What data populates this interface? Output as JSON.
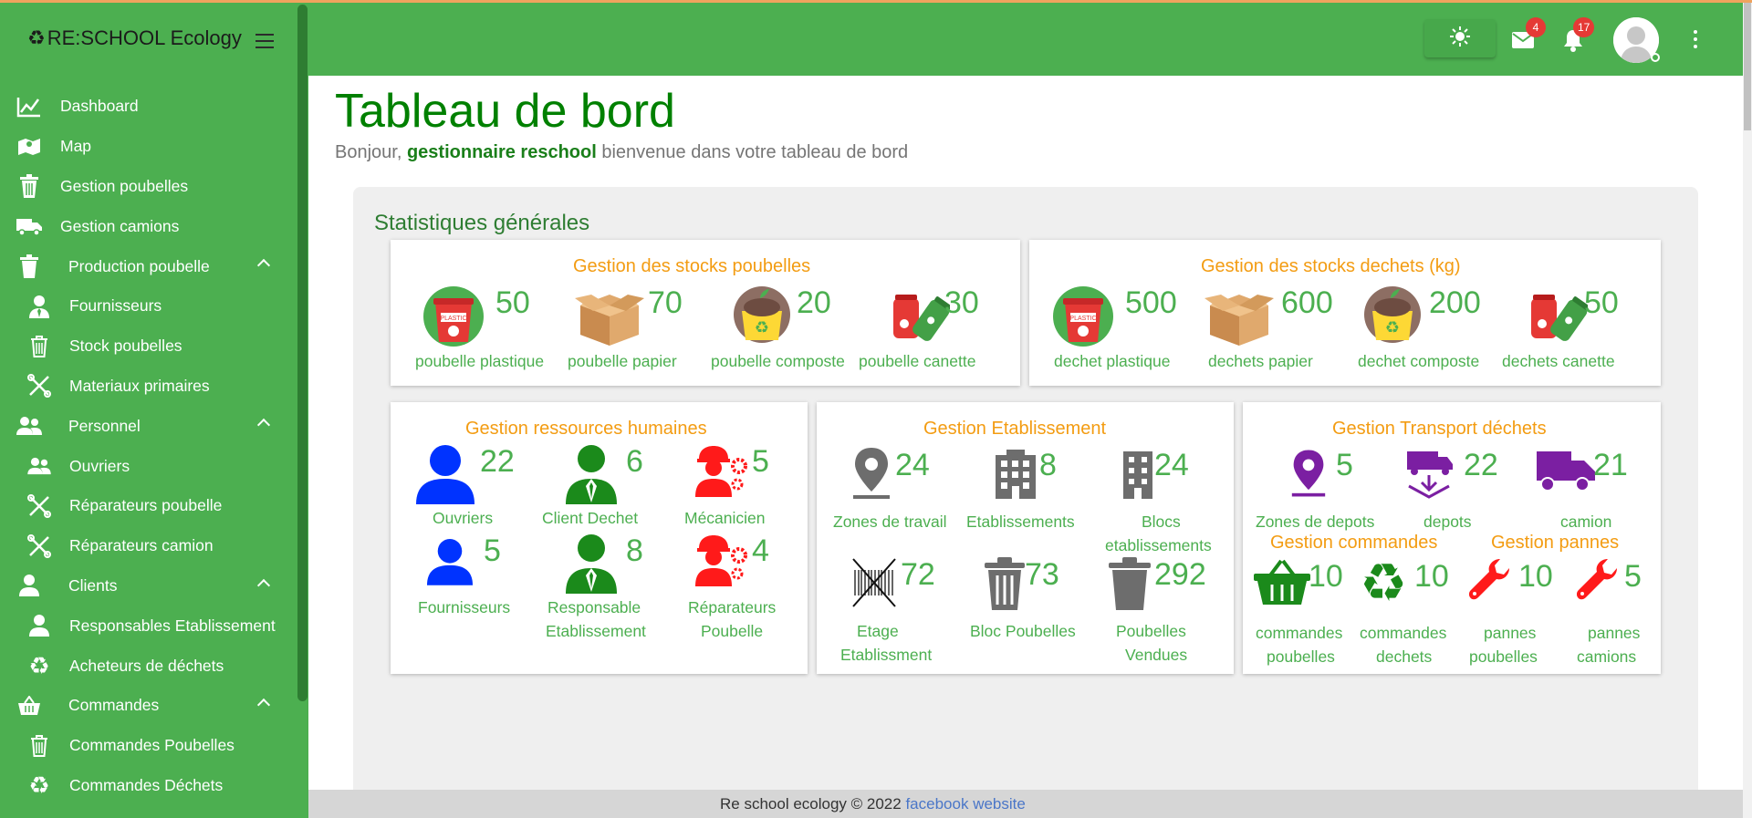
{
  "app": {
    "brand_logo": "♻",
    "brand_name": "RE:SCHOOL Ecology"
  },
  "sidebar": {
    "items": [
      {
        "label": "Dashboard",
        "icon": "chart-line-icon",
        "level": 0
      },
      {
        "label": "Map",
        "icon": "map-icon",
        "level": 0
      },
      {
        "label": "Gestion poubelles",
        "icon": "trash-icon",
        "level": 0
      },
      {
        "label": "Gestion camions",
        "icon": "truck-icon",
        "level": 0
      },
      {
        "label": "Production poubelle",
        "icon": "trash-icon",
        "level": "group"
      },
      {
        "label": "Fournisseurs",
        "icon": "user-tie-icon",
        "level": 1
      },
      {
        "label": "Stock poubelles",
        "icon": "trash-outline-icon",
        "level": 1
      },
      {
        "label": "Materiaux primaires",
        "icon": "tools-icon",
        "level": 1
      },
      {
        "label": "Personnel",
        "icon": "users-icon",
        "level": "group"
      },
      {
        "label": "Ouvriers",
        "icon": "users-icon",
        "level": 1
      },
      {
        "label": "Réparateurs poubelle",
        "icon": "tools-icon",
        "level": 1
      },
      {
        "label": "Réparateurs camion",
        "icon": "tools-icon",
        "level": 1
      },
      {
        "label": "Clients",
        "icon": "user-icon",
        "level": "group"
      },
      {
        "label": "Responsables Etablissement",
        "icon": "user-icon",
        "level": 1
      },
      {
        "label": "Acheteurs de déchets",
        "icon": "recycle-icon",
        "level": 1
      },
      {
        "label": "Commandes",
        "icon": "basket-icon",
        "level": "group"
      },
      {
        "label": "Commandes Poubelles",
        "icon": "trash-outline-icon",
        "level": 1
      },
      {
        "label": "Commandes Déchets",
        "icon": "recycle-icon",
        "level": 1
      }
    ]
  },
  "header": {
    "mail_badge": "4",
    "notif_badge": "17"
  },
  "page": {
    "title": "Tableau de bord",
    "greeting": "Bonjour,",
    "user": "gestionnaire reschool",
    "welcome": "bienvenue dans votre tableau de bord",
    "section_title": "Statistiques générales"
  },
  "stocks_poubelles": {
    "title": "Gestion des stocks poubelles",
    "items": [
      {
        "value": "50",
        "label": "poubelle plastique"
      },
      {
        "value": "70",
        "label": "poubelle papier"
      },
      {
        "value": "20",
        "label": "poubelle composte"
      },
      {
        "value": "30",
        "label": "poubelle canette"
      }
    ]
  },
  "stocks_dechets": {
    "title": "Gestion des stocks dechets (kg)",
    "items": [
      {
        "value": "500",
        "label": "dechet plastique"
      },
      {
        "value": "600",
        "label": "dechets papier"
      },
      {
        "value": "200",
        "label": "dechet composte"
      },
      {
        "value": "50",
        "label": "dechets canette"
      }
    ]
  },
  "rh": {
    "title": "Gestion ressources humaines",
    "items": [
      {
        "value": "22",
        "label": "Ouvriers"
      },
      {
        "value": "6",
        "label": "Client Dechet"
      },
      {
        "value": "5",
        "label": "Mécanicien"
      },
      {
        "value": "5",
        "label": "Fournisseurs"
      },
      {
        "value": "8",
        "label": "Responsable",
        "label2": "Etablissement"
      },
      {
        "value": "4",
        "label": "Réparateurs",
        "label2": "Poubelle"
      }
    ]
  },
  "etab": {
    "title": "Gestion Etablissement",
    "items": [
      {
        "value": "24",
        "label": "Zones de travail"
      },
      {
        "value": "8",
        "label": "Etablissements"
      },
      {
        "value": "24",
        "label": "Blocs",
        "label2": "etablissements"
      },
      {
        "value": "72",
        "label": "Etage",
        "label2": "Etablissment"
      },
      {
        "value": "73",
        "label": "Bloc Poubelles"
      },
      {
        "value": "292",
        "label": "Poubelles",
        "label2": "Vendues"
      }
    ]
  },
  "transport": {
    "title": "Gestion Transport déchets",
    "items": [
      {
        "value": "5",
        "label": "Zones de depots"
      },
      {
        "value": "22",
        "label": "depots"
      },
      {
        "value": "21",
        "label": "camion"
      }
    ]
  },
  "commandes": {
    "title": "Gestion commandes",
    "items": [
      {
        "value": "10",
        "label": "commandes",
        "label2": "poubelles"
      },
      {
        "value": "10",
        "label": "commandes",
        "label2": "dechets"
      }
    ]
  },
  "pannes": {
    "title": "Gestion pannes",
    "items": [
      {
        "value": "10",
        "label": "pannes",
        "label2": "poubelles"
      },
      {
        "value": "5",
        "label": "pannes",
        "label2": "camions"
      }
    ]
  },
  "footer": {
    "text": "Re school ecology © 2022",
    "link1": "facebook",
    "link2": "website"
  },
  "colors": {
    "primary": "#4caf50",
    "title_green": "#008000",
    "card_title": "#f39c12",
    "rh_blue": "#0033ff",
    "rh_green": "#1b8a1b",
    "rh_red": "#ff1a1a",
    "transport_purple": "#7b1fa2",
    "etab_grey": "#6d6d6d"
  }
}
